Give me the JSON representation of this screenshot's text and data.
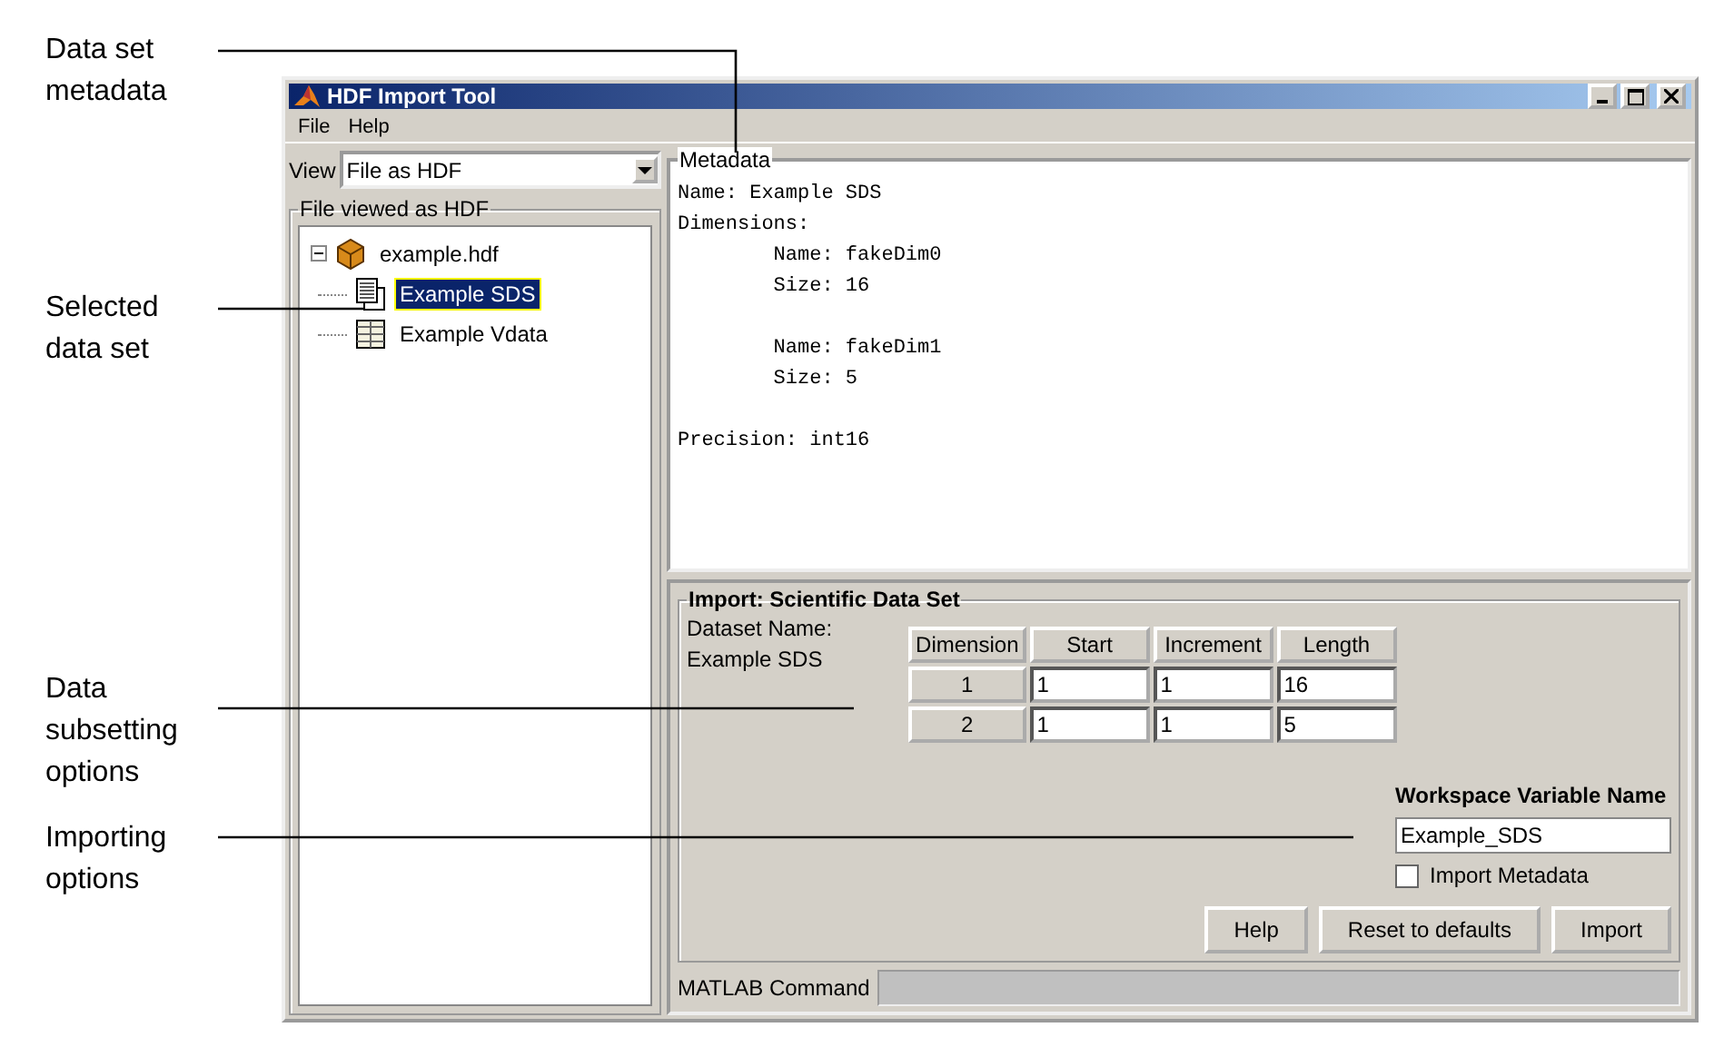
{
  "callouts": [
    {
      "text": "Data set\nmetadata"
    },
    {
      "text": "Selected\ndata set"
    },
    {
      "text": "Data\nsubsetting\noptions"
    },
    {
      "text": "Importing\noptions"
    }
  ],
  "window": {
    "title": "HDF Import Tool"
  },
  "menu": [
    "File",
    "Help"
  ],
  "view": {
    "label": "View",
    "value": "File as HDF"
  },
  "tree": {
    "title": "File viewed as HDF",
    "items": [
      {
        "label": "example.hdf",
        "kind": "file",
        "expanded": true,
        "selected": false,
        "children": [
          {
            "label": "Example SDS",
            "kind": "sds",
            "selected": true
          },
          {
            "label": "Example Vdata",
            "kind": "vdata",
            "selected": false
          }
        ]
      }
    ]
  },
  "metadata": {
    "title": "Metadata",
    "text": "Name: Example SDS\nDimensions:\n        Name: fakeDim0\n        Size: 16\n\n        Name: fakeDim1\n        Size: 5\n\nPrecision: int16"
  },
  "import": {
    "title": "Import: Scientific Data Set",
    "dataset_label": "Dataset Name:",
    "dataset_name": "Example SDS",
    "columns": [
      "Dimension",
      "Start",
      "Increment",
      "Length"
    ],
    "rows": [
      [
        "1",
        "1",
        "1",
        "16"
      ],
      [
        "2",
        "1",
        "1",
        "5"
      ]
    ],
    "workspace_label": "Workspace Variable Name",
    "workspace_value": "Example_SDS",
    "import_metadata": {
      "label": "Import Metadata",
      "checked": false
    },
    "buttons": [
      "Help",
      "Reset to defaults",
      "Import"
    ],
    "command_label": "MATLAB Command"
  }
}
